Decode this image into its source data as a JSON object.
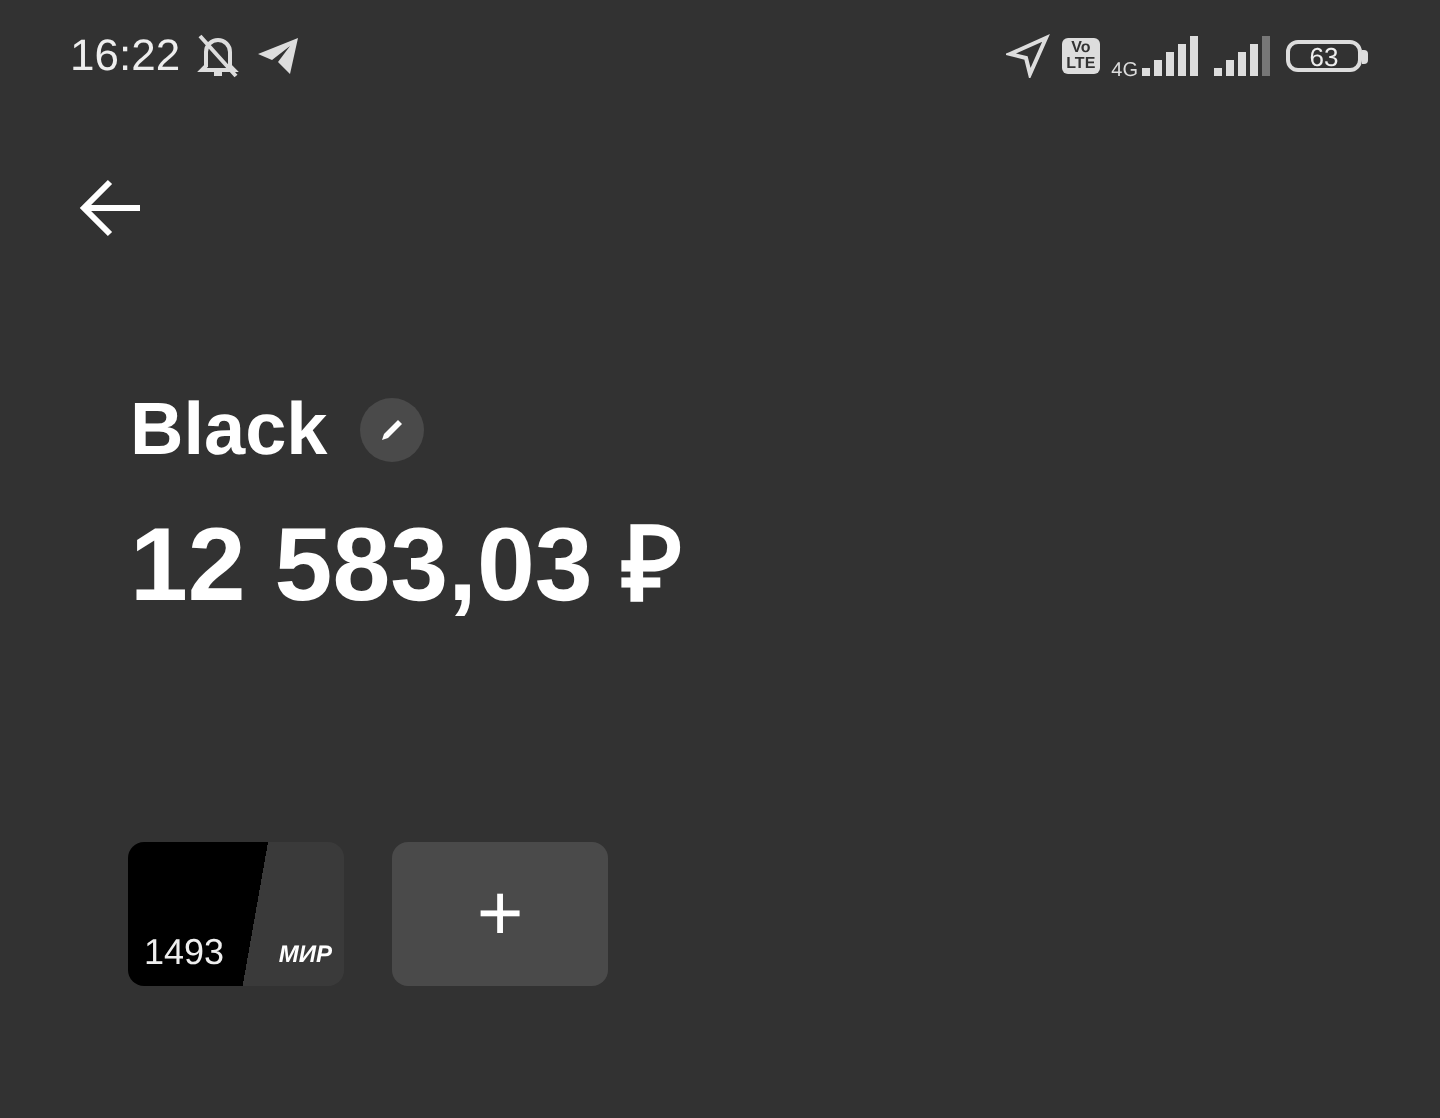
{
  "status_bar": {
    "time": "16:22",
    "volte": [
      "Vo",
      "LTE"
    ],
    "network": "4G",
    "battery": "63"
  },
  "account": {
    "name": "Black",
    "balance": "12 583,03 ₽"
  },
  "cards": [
    {
      "number": "1493",
      "brand": "МИР"
    }
  ],
  "add_button": {
    "label": "+"
  }
}
